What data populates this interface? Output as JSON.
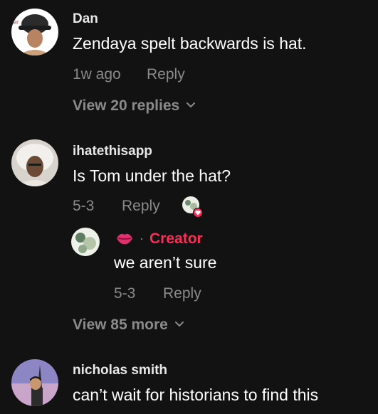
{
  "comments": [
    {
      "username": "Dan",
      "text": "Zendaya spelt backwards is hat.",
      "time": "1w ago",
      "reply_label": "Reply",
      "view_replies": "View 20 replies"
    },
    {
      "username": "ihatethisapp",
      "text": "Is Tom under the hat?",
      "time": "5-3",
      "reply_label": "Reply",
      "reply": {
        "creator_label": "Creator",
        "separator": "·",
        "text": "we aren’t sure",
        "time": "5-3",
        "reply_label": "Reply"
      },
      "view_more": "View 85 more"
    },
    {
      "username": "nicholas smith",
      "text": "can’t wait for historians to find this"
    }
  ],
  "colors": {
    "background": "#121212",
    "creator_accent": "#fe2c55",
    "secondary_text": "#8a8a8a"
  },
  "icons": {
    "chevron": "chevron-down-icon",
    "creator_badge": "lips-icon",
    "liked_by_creator": "heart-icon"
  }
}
